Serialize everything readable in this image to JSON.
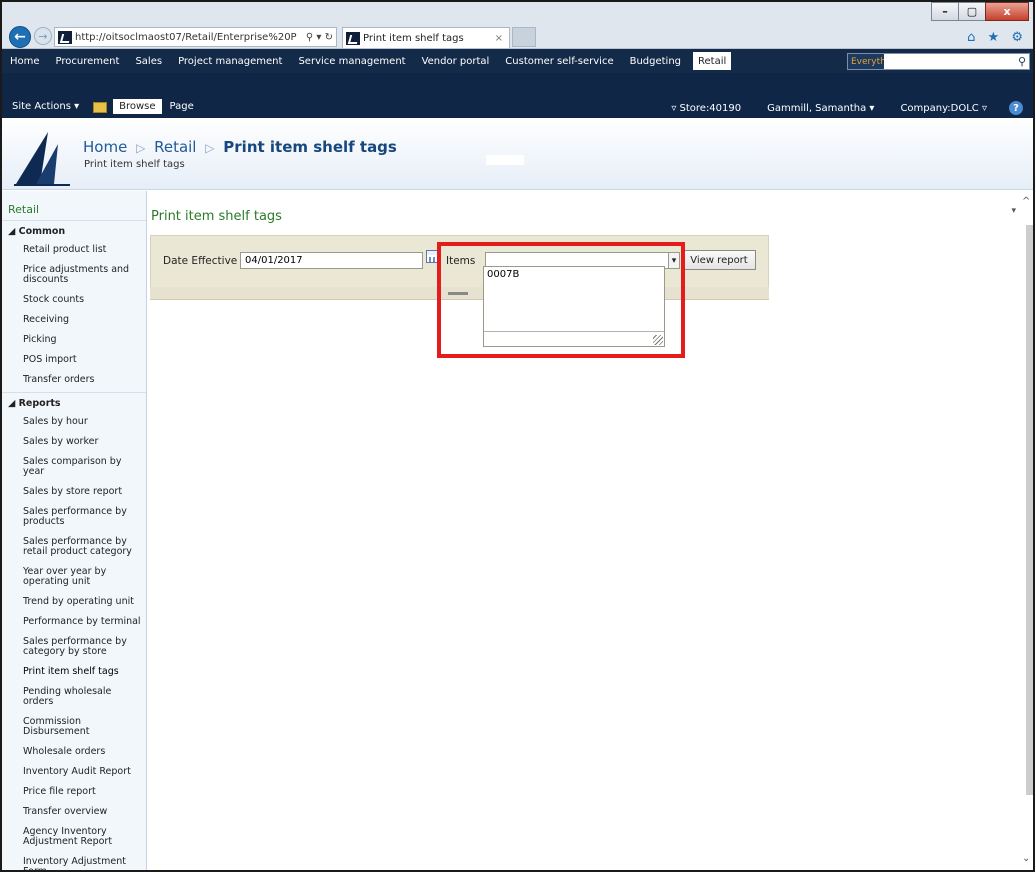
{
  "browser": {
    "address_url": "http://oitsoclmaost07/Retail/Enterprise%20P",
    "address_controls": "⚲ ▾ ↻",
    "tab_title": "Print item shelf tags",
    "tab_close": "×",
    "window_buttons": {
      "minimize": "–",
      "restore": "▢",
      "close": "x"
    },
    "toolbar_icons": "⌂ ★ ⚙"
  },
  "global_nav": {
    "items": [
      "Home",
      "Procurement",
      "Sales",
      "Project management",
      "Service management",
      "Vendor portal",
      "Customer self-service",
      "Budgeting"
    ],
    "active": "Retail",
    "search_scope": "Everything",
    "search_value": ""
  },
  "ribbon": {
    "site_actions": "Site Actions ▾",
    "tabs": [
      "Browse",
      "Page"
    ],
    "store": "▿ Store:40190",
    "user": "Gammill, Samantha ▾",
    "company": "Company:DOLC ▿",
    "help": "?"
  },
  "header": {
    "crumbs": [
      "Home",
      "Retail",
      "Print item shelf tags"
    ],
    "crumb_sep": "▷",
    "subtitle": "Print item shelf tags"
  },
  "left_nav": {
    "root": "Retail",
    "common_heading": "◢ Common",
    "common_items": [
      "Retail product list",
      "Price adjustments and discounts",
      "Stock counts",
      "Receiving",
      "Picking",
      "POS import",
      "Transfer orders"
    ],
    "reports_heading": "◢ Reports",
    "reports_items": [
      "Sales by hour",
      "Sales by worker",
      "Sales comparison by year",
      "Sales by store report",
      "Sales performance by products",
      "Sales performance by retail product category",
      "Year over year by operating unit",
      "Trend by operating unit",
      "Performance by terminal",
      "Sales performance by category by store",
      "Print item shelf tags",
      "Pending wholesale orders",
      "Commission Disbursement",
      "Wholesale orders",
      "Inventory Audit Report",
      "Price file report",
      "Transfer overview",
      "Agency Inventory Adjustment Report",
      "Inventory Adjustment Form"
    ],
    "active_item": "Print item shelf tags"
  },
  "main": {
    "title": "Print item shelf tags",
    "collapse_arrow": "▾",
    "date_label": "Date Effective",
    "date_value": "04/01/2017",
    "items_label": "Items",
    "items_value": "",
    "items_dropdown_arrow": "▾",
    "items_text": "0007B",
    "view_report_label": "View report"
  },
  "scrollbar": {
    "up": "^",
    "down": "⌄"
  },
  "colors": {
    "nav_dark": "#132a48",
    "ribbon": "#0f2646",
    "accent_green": "#2b7a2b",
    "highlight_red": "#e51c1c"
  }
}
